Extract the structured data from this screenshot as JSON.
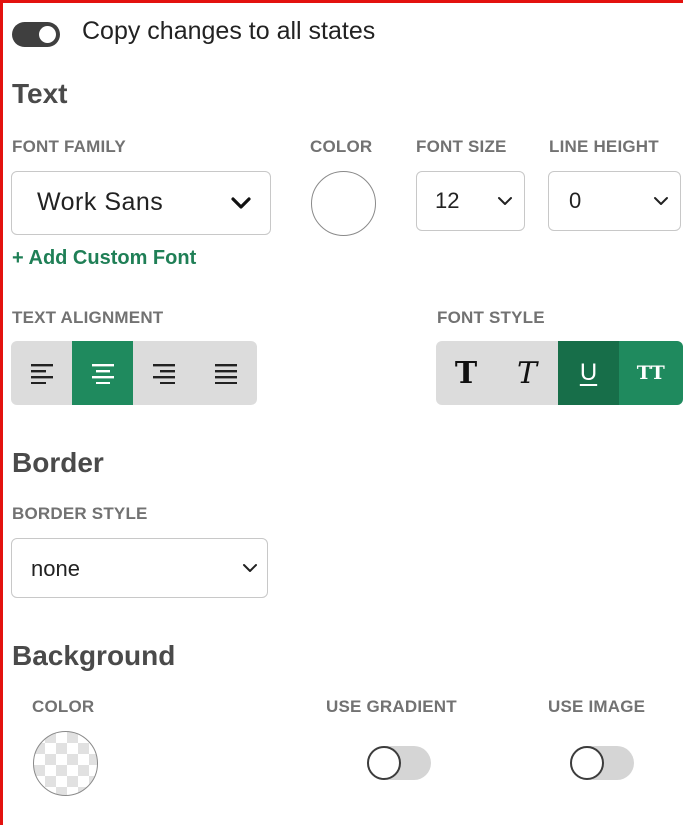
{
  "copy_changes": {
    "label": "Copy changes to all states",
    "enabled": true
  },
  "text_section": {
    "title": "Text",
    "font_family": {
      "label": "FONT FAMILY",
      "value": "Work Sans"
    },
    "color": {
      "label": "COLOR",
      "value": "#ffffff"
    },
    "font_size": {
      "label": "FONT SIZE",
      "value": "12"
    },
    "line_height": {
      "label": "LINE HEIGHT",
      "value": "0"
    },
    "add_custom_font": "+ Add Custom Font",
    "text_alignment": {
      "label": "TEXT ALIGNMENT",
      "options": [
        "align-left-icon",
        "align-center-icon",
        "align-right-icon",
        "align-justify-icon"
      ],
      "selected": "align-center-icon"
    },
    "font_style": {
      "label": "FONT STYLE",
      "bold_glyph": "T",
      "italic_glyph": "T",
      "underline_glyph": "U",
      "uppercase_glyph": "TT",
      "active": [
        "underline",
        "uppercase"
      ]
    }
  },
  "border_section": {
    "title": "Border",
    "border_style": {
      "label": "BORDER STYLE",
      "value": "none"
    }
  },
  "background_section": {
    "title": "Background",
    "color": {
      "label": "COLOR",
      "value": "transparent"
    },
    "use_gradient": {
      "label": "USE GRADIENT",
      "enabled": false
    },
    "use_image": {
      "label": "USE IMAGE",
      "enabled": false
    }
  },
  "colors": {
    "accent_green": "#1f8a5e",
    "accent_green_dark": "#176e49",
    "link_green": "#1f7f56",
    "frame_red": "#e3120f"
  }
}
